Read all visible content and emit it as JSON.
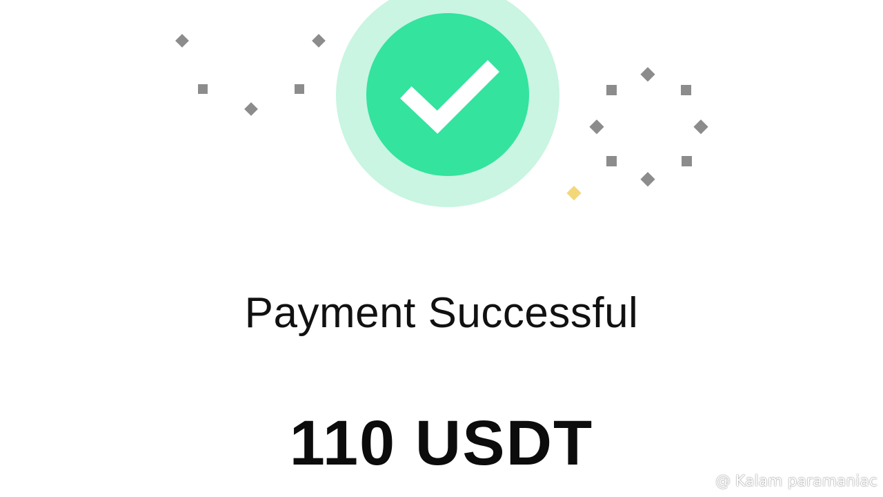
{
  "status": {
    "title": "Payment Successful",
    "amount": "110 USDT"
  },
  "badge": {
    "icon": "checkmark-icon",
    "outer_color": "#c9f5e2",
    "inner_color": "#33e39e"
  },
  "confetti": {
    "gray_color": "#8c8c8c",
    "accent_color": "#f3d87a"
  },
  "watermark": {
    "icon": "binance-logo-icon",
    "text": "@ Kalam paramaniac"
  }
}
